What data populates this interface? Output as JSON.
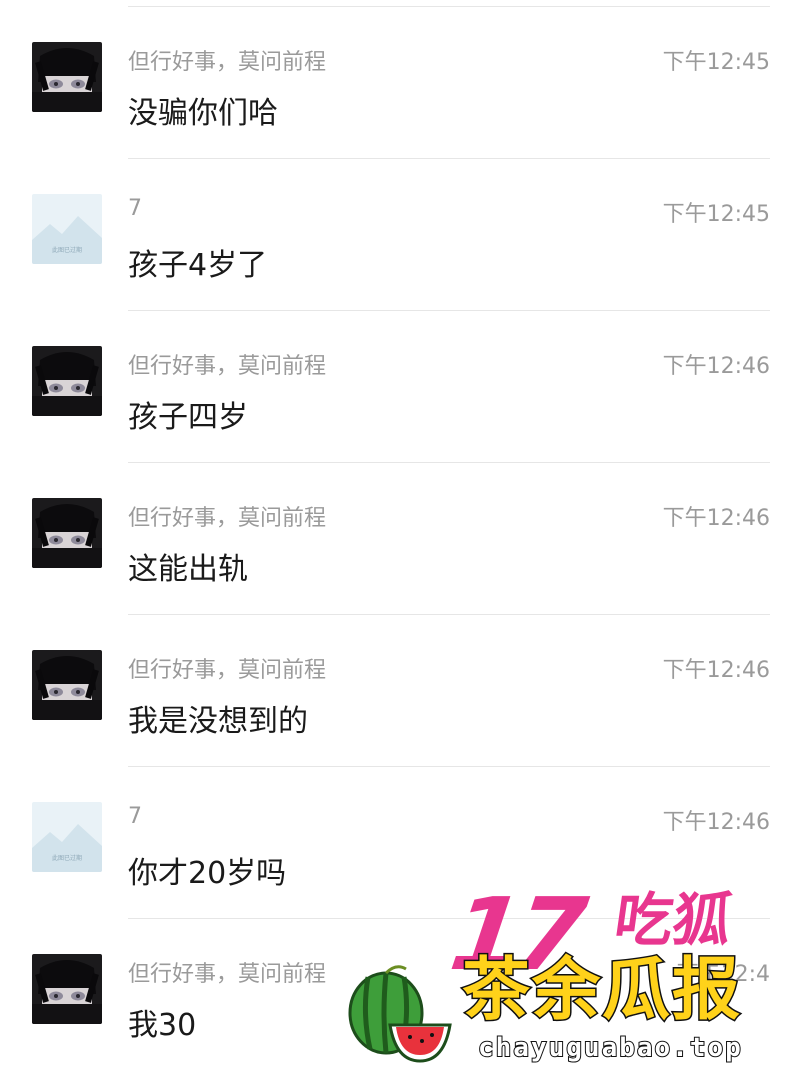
{
  "messages": [
    {
      "sender": "但行好事，莫问前程",
      "time": "下午12:45",
      "text": "没骗你们哈",
      "avatar": "anime-girl-avatar"
    },
    {
      "sender": "7",
      "time": "下午12:45",
      "text": "孩子4岁了",
      "avatar": "placeholder-image-avatar"
    },
    {
      "sender": "但行好事，莫问前程",
      "time": "下午12:46",
      "text": "孩子四岁",
      "avatar": "anime-girl-avatar"
    },
    {
      "sender": "但行好事，莫问前程",
      "time": "下午12:46",
      "text": "这能出轨",
      "avatar": "anime-girl-avatar"
    },
    {
      "sender": "但行好事，莫问前程",
      "time": "下午12:46",
      "text": "我是没想到的",
      "avatar": "anime-girl-avatar"
    },
    {
      "sender": "7",
      "time": "下午12:46",
      "text": "你才20岁吗",
      "avatar": "placeholder-image-avatar"
    },
    {
      "sender": "但行好事，莫问前程",
      "time": "下午12:4",
      "text": "我30",
      "avatar": "anime-girl-avatar"
    }
  ],
  "placeholder_avatar_caption": "此图已过期",
  "watermark": {
    "number": "17",
    "brand": "吃狐",
    "title": "茶余瓜报",
    "url": "chayuguabao.top"
  },
  "colors": {
    "watermark_pink": "#e8368f",
    "watermark_yellow": "#ffd21a",
    "muted_text": "#9a9a9a"
  }
}
